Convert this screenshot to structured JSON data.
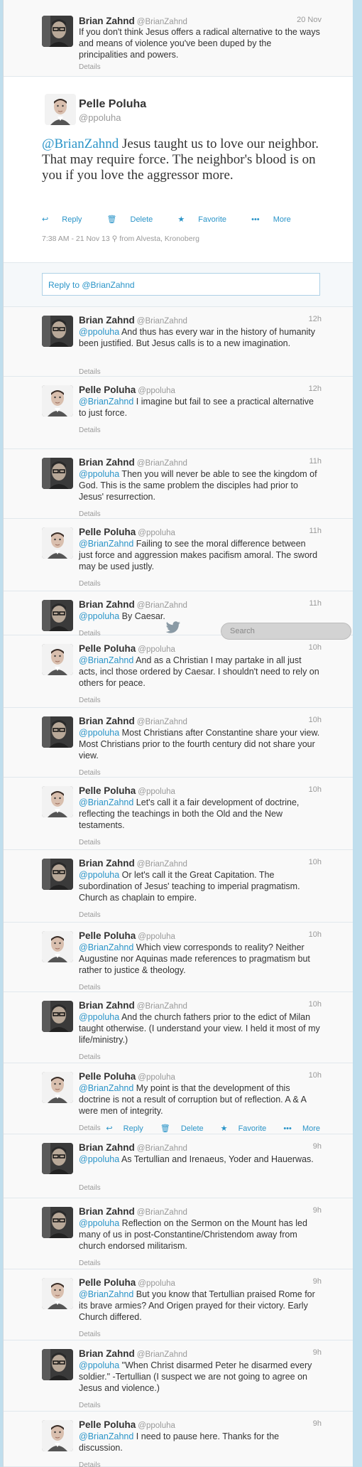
{
  "top_tweet": {
    "name": "Brian Zahnd",
    "handle": "@BrianZahnd",
    "time": "20 Nov",
    "text": "If you don't think Jesus offers a radical alternative to the ways and means of violence you've been duped by the principalities and powers.",
    "details": "Details"
  },
  "main_tweet": {
    "name": "Pelle Poluha",
    "handle": "@ppoluha",
    "mention": "@BrianZahnd",
    "text": " Jesus taught us to love our neighbor. That may require force. The neighbor's blood is on you if you love the aggressor more.",
    "actions": {
      "reply": "Reply",
      "delete": "Delete",
      "favorite": "Favorite",
      "more": "More"
    },
    "meta": "7:38 AM - 21 Nov 13",
    "location": "from Alvesta, Kronoberg"
  },
  "reply_box": {
    "placeholder": "Reply to @BrianZahnd"
  },
  "search": {
    "placeholder": "Search"
  },
  "replies": [
    {
      "name": "Brian Zahnd",
      "handle": "@BrianZahnd",
      "time": "12h",
      "mention": "@ppoluha",
      "text": " And thus has every war in the history of humanity been justified. But Jesus calls is to a new imagination.",
      "details": "Details"
    },
    {
      "name": "Pelle Poluha",
      "handle": "@ppoluha",
      "time": "12h",
      "mention": "@BrianZahnd",
      "text": " I imagine but fail to see a practical alternative to just force.",
      "details": "Details"
    },
    {
      "name": "Brian Zahnd",
      "handle": "@BrianZahnd",
      "time": "11h",
      "mention": "@ppoluha",
      "text": " Then you will never be able to see the kingdom of God. This is the same problem the disciples had prior to Jesus' resurrection.",
      "details": "Details"
    },
    {
      "name": "Pelle Poluha",
      "handle": "@ppoluha",
      "time": "11h",
      "mention": "@BrianZahnd",
      "text": " Failing to see the moral difference between just force and aggression makes pacifism amoral. The sword may be used justly.",
      "details": "Details"
    },
    {
      "name": "Brian Zahnd",
      "handle": "@BrianZahnd",
      "time": "11h",
      "mention": "@ppoluha",
      "text": " By Caesar.",
      "details": "Details"
    },
    {
      "name": "Pelle Poluha",
      "handle": "@ppoluha",
      "time": "10h",
      "mention": "@BrianZahnd",
      "text": " And as a Christian I may partake in all just acts, incl those ordered by Caesar. I shouldn't need to rely on others for peace.",
      "details": "Details"
    },
    {
      "name": "Brian Zahnd",
      "handle": "@BrianZahnd",
      "time": "10h",
      "mention": "@ppoluha",
      "text": " Most Christians after Constantine share your view. Most Christians prior to the fourth century did not share your view.",
      "details": "Details"
    },
    {
      "name": "Pelle Poluha",
      "handle": "@ppoluha",
      "time": "10h",
      "mention": "@BrianZahnd",
      "text": " Let's call it a fair development of doctrine, reflecting the teachings in both the Old and the New testaments.",
      "details": "Details"
    },
    {
      "name": "Brian Zahnd",
      "handle": "@BrianZahnd",
      "time": "10h",
      "mention": "@ppoluha",
      "text": " Or let's call it the Great Capitation. The subordination of Jesus' teaching to imperial pragmatism. Church as chaplain to empire.",
      "details": "Details"
    },
    {
      "name": "Pelle Poluha",
      "handle": "@ppoluha",
      "time": "10h",
      "mention": "@BrianZahnd",
      "text": " Which view corresponds to reality? Neither Augustine nor Aquinas made references to pragmatism but rather to justice & theology.",
      "details": "Details"
    },
    {
      "name": "Brian Zahnd",
      "handle": "@BrianZahnd",
      "time": "10h",
      "mention": "@ppoluha",
      "text": " And the church fathers prior to the edict of Milan taught otherwise. (I understand your view. I held it most of my life/ministry.)",
      "details": "Details"
    },
    {
      "name": "Pelle Poluha",
      "handle": "@ppoluha",
      "time": "10h",
      "mention": "@BrianZahnd",
      "text": " My point is that the development of this doctrine is not a result of corruption but of reflection. A & A were men of integrity.",
      "details": "Details",
      "actions": {
        "reply": "Reply",
        "delete": "Delete",
        "favorite": "Favorite",
        "more": "More"
      }
    },
    {
      "name": "Brian Zahnd",
      "handle": "@BrianZahnd",
      "time": "9h",
      "mention": "@ppoluha",
      "text": " As Tertullian and Irenaeus, Yoder and Hauerwas.",
      "details": "Details"
    },
    {
      "name": "Brian Zahnd",
      "handle": "@BrianZahnd",
      "time": "9h",
      "mention": "@ppoluha",
      "text": " Reflection on the Sermon on the Mount has led many of us in post-Constantine/Christendom away from church endorsed militarism.",
      "details": "Details"
    },
    {
      "name": "Pelle Poluha",
      "handle": "@ppoluha",
      "time": "9h",
      "mention": "@BrianZahnd",
      "text": " But you know that Tertullian praised Rome for its brave armies? And Origen prayed for their victory. Early Church differed.",
      "details": "Details"
    },
    {
      "name": "Brian Zahnd",
      "handle": "@BrianZahnd",
      "time": "9h",
      "mention": "@ppoluha",
      "text": " \"When Christ disarmed Peter he disarmed every soldier.\" -Tertullian (I suspect we are not going to agree on Jesus and violence.)",
      "details": "Details"
    },
    {
      "name": "Pelle Poluha",
      "handle": "@ppoluha",
      "time": "9h",
      "mention": "@BrianZahnd",
      "text": " I need to pause here. Thanks for the discussion.",
      "details": "Details"
    }
  ]
}
